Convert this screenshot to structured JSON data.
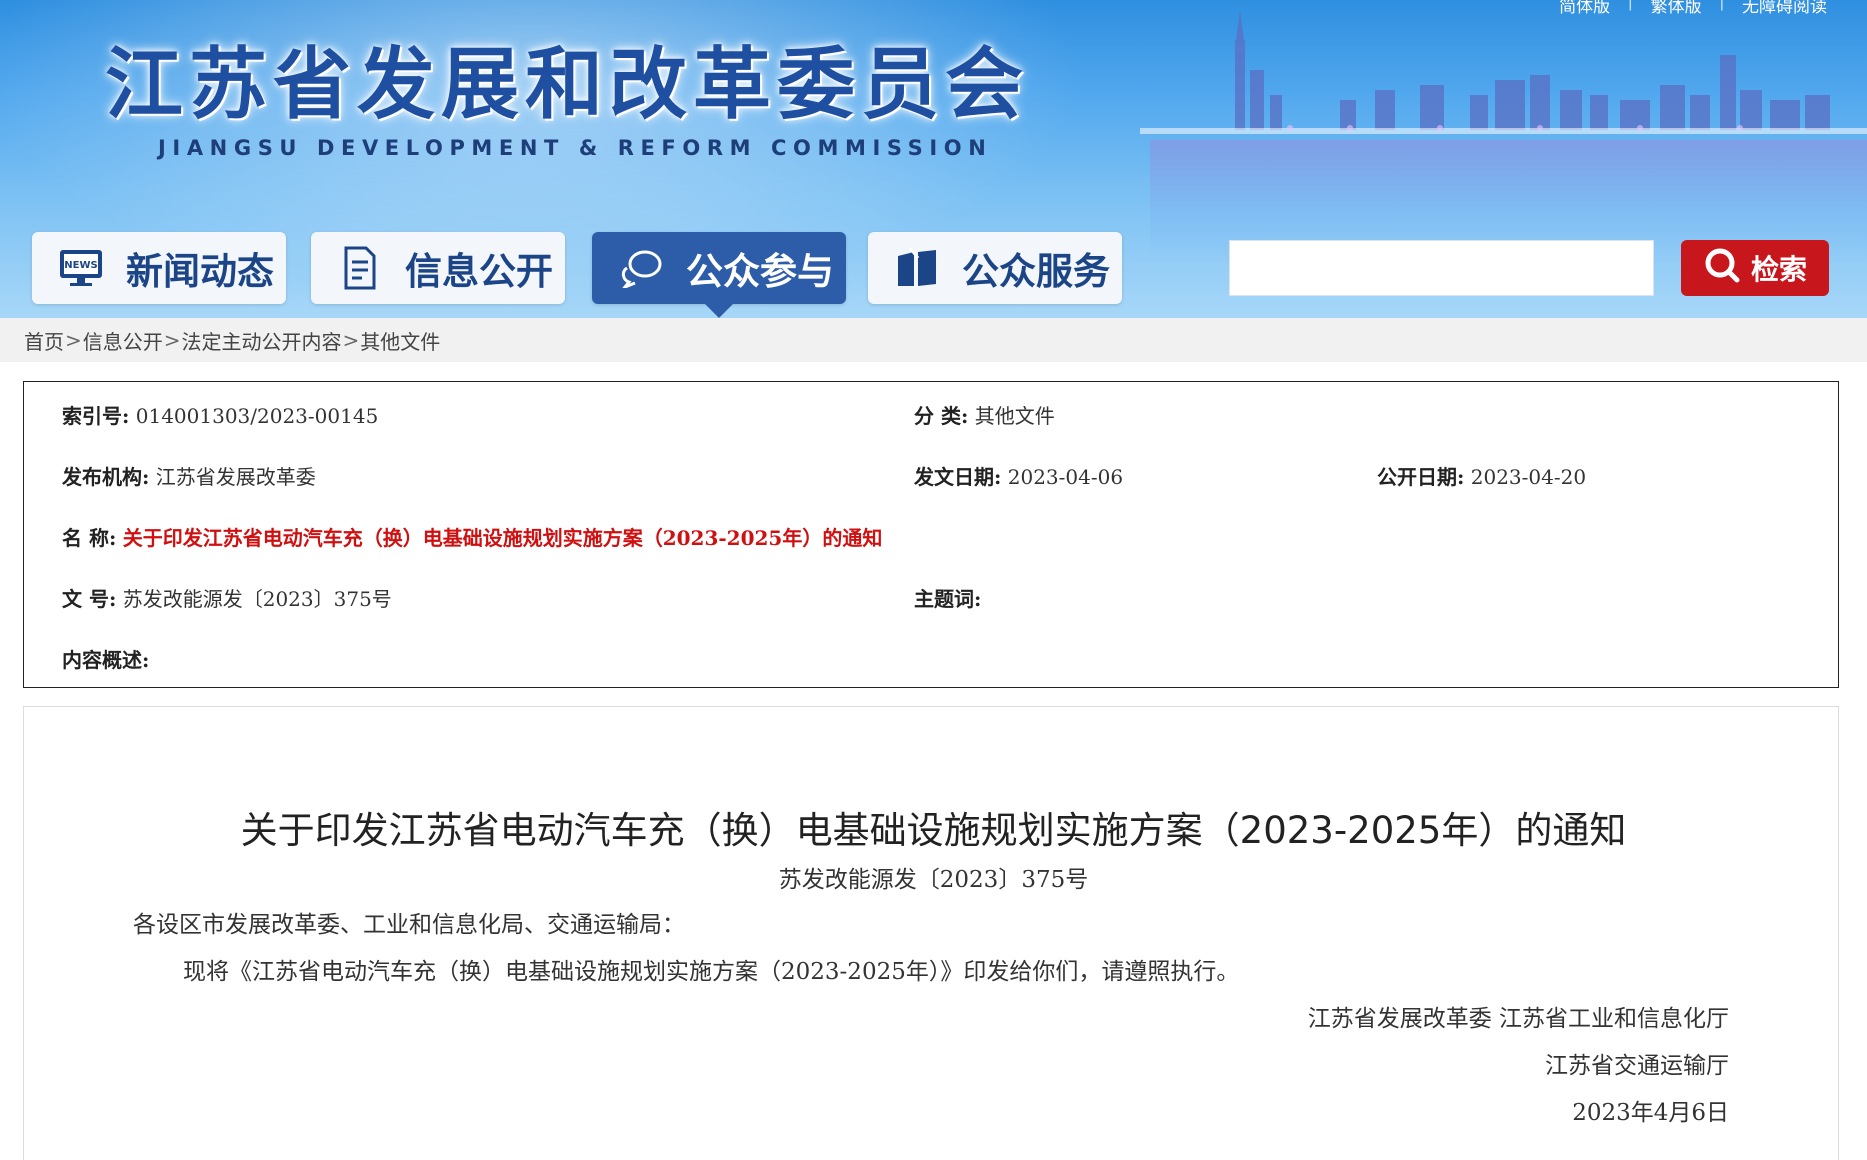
{
  "header": {
    "site_title": "江苏省发展和改革委员会",
    "site_subtitle": "JIANGSU DEVELOPMENT & REFORM COMMISSION",
    "top_links": [
      "简体版",
      "繁体版",
      "无障碍阅读"
    ],
    "colors": {
      "title": "#1f4fa0",
      "sky": "#52a8ee"
    }
  },
  "nav": {
    "items": [
      {
        "label": "新闻动态",
        "icon": "news-monitor-icon"
      },
      {
        "label": "信息公开",
        "icon": "document-icon"
      },
      {
        "label": "公众参与",
        "icon": "chat-bubble-icon",
        "active": true
      },
      {
        "label": "公众服务",
        "icon": "book-icon"
      }
    ],
    "active_color": "#2d5da8"
  },
  "search": {
    "placeholder": "",
    "button_label": "检索",
    "button_color": "#c8161d"
  },
  "breadcrumb": [
    "首页",
    "信息公开",
    "法定主动公开内容",
    "其他文件"
  ],
  "meta": {
    "index_label": "索引号:",
    "index_value": "014001303/2023-00145",
    "category_label": "分  类:",
    "category_value": "其他文件",
    "publisher_label": "发布机构:",
    "publisher_value": "江苏省发展改革委",
    "issue_date_label": "发文日期:",
    "issue_date_value": "2023-04-06",
    "public_date_label": "公开日期:",
    "public_date_value": "2023-04-20",
    "name_label": "名  称:",
    "name_value": "关于印发江苏省电动汽车充（换）电基础设施规划实施方案（2023-2025年）的通知",
    "docno_label": "文  号:",
    "docno_value": "苏发改能源发〔2023〕375号",
    "keywords_label": "主题词:",
    "keywords_value": "",
    "summary_label": "内容概述:",
    "summary_value": ""
  },
  "document": {
    "title": "关于印发江苏省电动汽车充（换）电基础设施规划实施方案（2023-2025年）的通知",
    "number": "苏发改能源发〔2023〕375号",
    "salutation": "各设区市发展改革委、工业和信息化局、交通运输局：",
    "body": "现将《江苏省电动汽车充（换）电基础设施规划实施方案（2023-2025年）》印发给你们，请遵照执行。",
    "signers_line1": "江苏省发展改革委      江苏省工业和信息化厅",
    "signers_line2": "江苏省交通运输厅",
    "date": "2023年4月6日"
  }
}
